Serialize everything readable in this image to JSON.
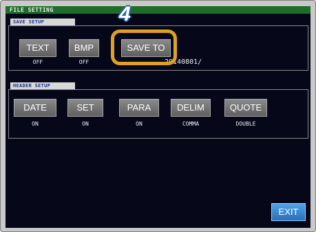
{
  "window": {
    "title": "FILE SETTING"
  },
  "save_setup": {
    "label": "SAVE SETUP",
    "buttons": [
      {
        "label": "TEXT",
        "value": "OFF"
      },
      {
        "label": "BMP",
        "value": "OFF"
      },
      {
        "label": "SAVE TO",
        "value": "20140801/"
      }
    ]
  },
  "header_setup": {
    "label": "HEADER SETUP",
    "buttons": [
      {
        "label": "DATE",
        "value": "ON"
      },
      {
        "label": "SET",
        "value": "ON"
      },
      {
        "label": "PARA",
        "value": "ON"
      },
      {
        "label": "DELIM",
        "value": "COMMA"
      },
      {
        "label": "QUOTE",
        "value": "DOUBLE"
      }
    ]
  },
  "exit_label": "EXIT",
  "annotation": {
    "step": "4",
    "highlight_color": "#e0a020"
  }
}
